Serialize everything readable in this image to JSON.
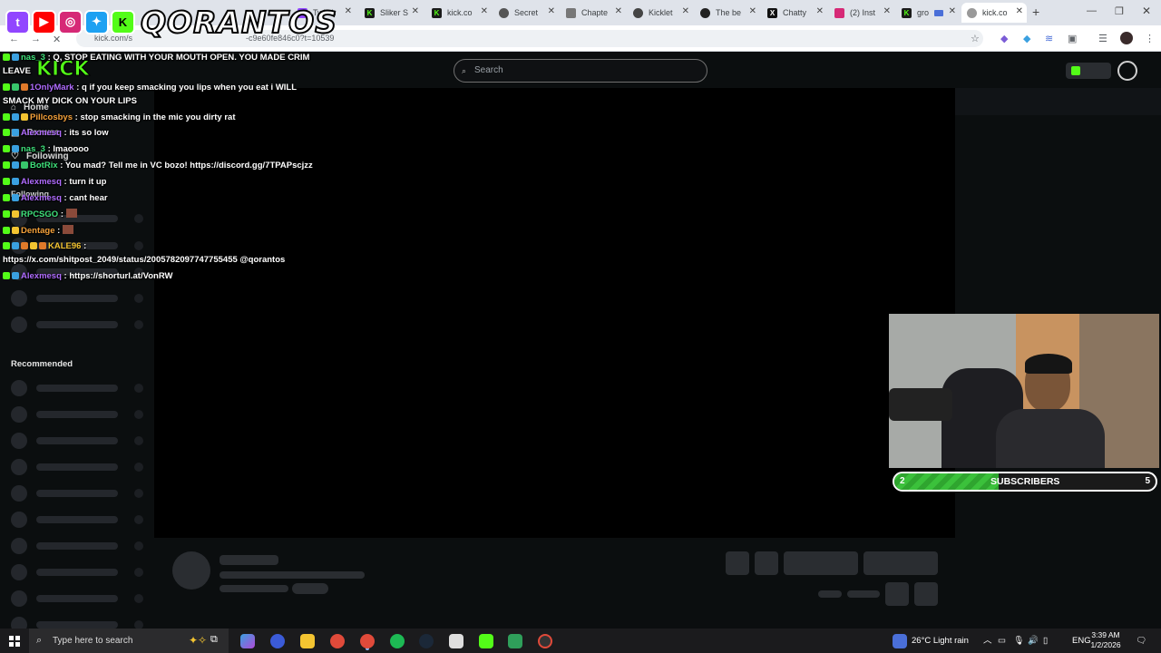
{
  "browser": {
    "tabs": [
      {
        "label": "Twitch"
      },
      {
        "label": "Sliker S"
      },
      {
        "label": "kick.co"
      },
      {
        "label": "Secret"
      },
      {
        "label": "Chapte"
      },
      {
        "label": "Kicklet"
      },
      {
        "label": "The be"
      },
      {
        "label": "Chatty"
      },
      {
        "label": "(2) Inst"
      },
      {
        "label": "gro"
      },
      {
        "label": "kick.co"
      }
    ],
    "url_start": "kick.com/s",
    "url_end": "-c9e60fe846c0?t=10539"
  },
  "overlay": {
    "brand": "QORANTOS",
    "chat": [
      {
        "user": "nas_3",
        "text": ": Q, STOP EATING WITH YOUR MOUTH OPEN. YOU MADE CRIM",
        "color": "#3ee07a"
      },
      {
        "user": "",
        "text": "LEAVE",
        "color": "#ffffff"
      },
      {
        "user": "1OnlyMark",
        "text": ": q if you keep smacking you lips when you eat i WILL",
        "color": "#b06cff"
      },
      {
        "user": "",
        "text": "SMACK MY DICK ON YOUR LIPS",
        "color": "#ffffff"
      },
      {
        "user": "Pillcosbys",
        "text": ": stop smacking in the mic you dirty rat",
        "color": "#f4a13a"
      },
      {
        "user": "Alexmesq",
        "text": ": its so low",
        "color": "#b06cff"
      },
      {
        "user": "nas_3",
        "text": ": lmaoooo",
        "color": "#3ee07a"
      },
      {
        "user": "BotRix",
        "text": ": You mad? Tell me in VC bozo! https://discord.gg/7TPAPscjzz",
        "color": "#3ee07a"
      },
      {
        "user": "Alexmesq",
        "text": ": turn it up",
        "color": "#b06cff"
      },
      {
        "user": "Alexmesq",
        "text": ": cant hear",
        "color": "#b06cff"
      },
      {
        "user": "RPCSGO",
        "text": ":",
        "color": "#3ee07a"
      },
      {
        "user": "Dentage",
        "text": ":",
        "color": "#f4a13a"
      },
      {
        "user": "KALE96",
        "text": ":",
        "color": "#f3c431"
      },
      {
        "user": "",
        "text": "https://x.com/shitpost_2049/status/2005782097747755455 @qorantos",
        "color": "#ffffff"
      },
      {
        "user": "Alexmesq",
        "text": ": https://shorturl.at/VonRW",
        "color": "#b06cff"
      }
    ],
    "sub_goal": {
      "current": "2",
      "label": "SUBSCRIBERS",
      "target": "5",
      "progress": 0.4
    }
  },
  "kick": {
    "search_placeholder": "Search",
    "nav": {
      "home": "Home",
      "browse": "Browse",
      "following": "Following",
      "following_section": "Following",
      "recommended": "Recommended"
    }
  },
  "taskbar": {
    "search_placeholder": "Type here to search",
    "weather": "26°C  Light rain",
    "language": "ENG",
    "time": "3:39 AM",
    "date": "1/2/2026"
  }
}
